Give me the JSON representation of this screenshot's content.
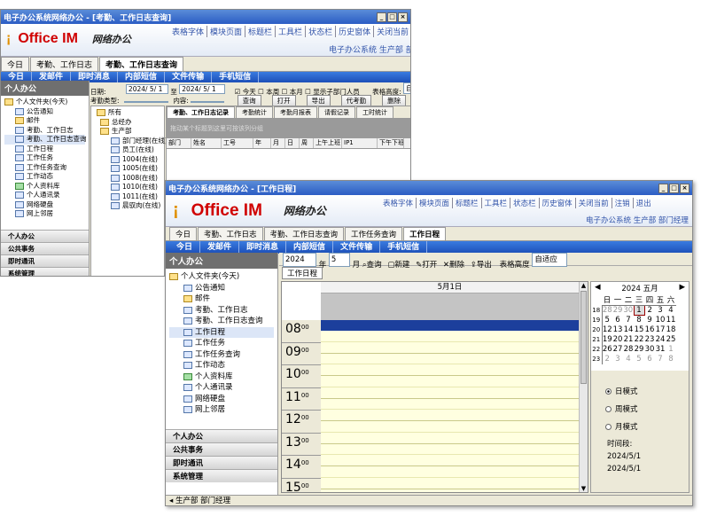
{
  "w1": {
    "title": "电子办公系统网络办公 - [考勤、工作日志查询]",
    "logo": "Office IM",
    "logo_cn": "网络办公",
    "menu": [
      "表格字体",
      "模块页面",
      "标题栏",
      "工具栏",
      "状态栏",
      "历史窗体",
      "关闭当前",
      "注销",
      "退出"
    ],
    "info": "电子办公系统 生产部 部门经理",
    "tabs": [
      "今日",
      "考勤、工作日志",
      "考勤、工作日志查询"
    ],
    "nav": [
      "今日",
      "发邮件",
      "即时消息",
      "内部短信",
      "文件传输",
      "手机短信"
    ],
    "side_title": "个人办公",
    "tree": [
      "个人文件夹(今天)",
      "公告通知",
      "邮件",
      "考勤、工作日志",
      "考勤、工作日志查询",
      "工作日程",
      "工作任务",
      "工作任务查询",
      "工作动态",
      "个人资料库",
      "个人通讯录",
      "网络硬盘",
      "网上邻居"
    ],
    "acc": [
      "个人办公",
      "公共事务",
      "即时通讯",
      "系统管理"
    ],
    "status": "生产部 部门经理",
    "f": {
      "date_label": "日期:",
      "date1": "2024/ 5/ 1",
      "to": "至",
      "date2": "2024/ 5/ 1",
      "today": "今天",
      "week": "本周",
      "month": "本月",
      "subdept": "显示子部门人员",
      "height_label": "表格高度:",
      "height_val": "自适应",
      "type_label": "考勤类型:",
      "content_label": "内容:",
      "btns": [
        "查询",
        "打开",
        "导出",
        "代考勤",
        "删除"
      ]
    },
    "dept": [
      "所有",
      "总经办",
      "生产部",
      "部门经理(在线)",
      "员工(在线)",
      "1004(在线)",
      "1005(在线)",
      "1008(在线)",
      "1010(在线)",
      "1011(在线)",
      "晨驭肉(在线)"
    ],
    "subtabs": [
      "考勤、工作日志记录",
      "考勤统计",
      "考勤月报表",
      "请假记录",
      "工时统计"
    ],
    "group_hint": "拖动某个标题到这里可按该列分组",
    "cols": [
      "部门",
      "姓名",
      "工号",
      "年",
      "月",
      "日",
      "周",
      "上午上班",
      "IP1",
      "下午下班"
    ]
  },
  "w2": {
    "title": "电子办公系统网络办公 - [工作日程]",
    "logo": "Office IM",
    "logo_cn": "网络办公",
    "menu": [
      "表格字体",
      "模块页面",
      "标题栏",
      "工具栏",
      "状态栏",
      "历史窗体",
      "关闭当前",
      "注销",
      "退出"
    ],
    "info": "电子办公系统 生产部 部门经理",
    "tabs": [
      "今日",
      "考勤、工作日志",
      "考勤、工作日志查询",
      "工作任务查询",
      "工作日程"
    ],
    "nav": [
      "今日",
      "发邮件",
      "即时消息",
      "内部短信",
      "文件传输",
      "手机短信"
    ],
    "side_title": "个人办公",
    "tree": [
      "个人文件夹(今天)",
      "公告通知",
      "邮件",
      "考勤、工作日志",
      "考勤、工作日志查询",
      "工作日程",
      "工作任务",
      "工作任务查询",
      "工作动态",
      "个人资料库",
      "个人通讯录",
      "网络硬盘",
      "网上邻居"
    ],
    "acc": [
      "个人办公",
      "公共事务",
      "即时通讯",
      "系统管理"
    ],
    "status": "生产部 部门经理",
    "tool": {
      "year": "2024",
      "year_unit": "年",
      "month": "5",
      "month_unit": "月",
      "query": "查询",
      "new": "新建",
      "open": "打开",
      "del": "删除",
      "export": "导出",
      "height_label": "表格高度",
      "height_val": "自适应"
    },
    "subtab": "工作日程",
    "day_header": "5月1日",
    "hours": [
      {
        "h": "08",
        "m": "00"
      },
      {
        "h": "09",
        "m": "00"
      },
      {
        "h": "10",
        "m": "00"
      },
      {
        "h": "11",
        "m": "00"
      },
      {
        "h": "12",
        "m": "00"
      },
      {
        "h": "13",
        "m": "00"
      },
      {
        "h": "14",
        "m": "00"
      },
      {
        "h": "15",
        "m": "00"
      }
    ],
    "cal": {
      "title": "2024 五月",
      "weekdays": [
        "日",
        "一",
        "二",
        "三",
        "四",
        "五",
        "六"
      ],
      "weeks": [
        [
          "18",
          "28",
          "29",
          "30",
          "1",
          "2",
          "3",
          "4"
        ],
        [
          "19",
          "5",
          "6",
          "7",
          "8",
          "9",
          "10",
          "11"
        ],
        [
          "20",
          "12",
          "13",
          "14",
          "15",
          "16",
          "17",
          "18"
        ],
        [
          "21",
          "19",
          "20",
          "21",
          "22",
          "23",
          "24",
          "25"
        ],
        [
          "22",
          "26",
          "27",
          "28",
          "29",
          "30",
          "31",
          "1"
        ],
        [
          "23",
          "2",
          "3",
          "4",
          "5",
          "6",
          "7",
          "8"
        ]
      ]
    },
    "modes": [
      "日模式",
      "周模式",
      "月模式"
    ],
    "period_label": "时间段:",
    "period_from": "2024/5/1",
    "period_to": "2024/5/1",
    "colors": {
      "accent": "#1c4fb8",
      "event": "#1c3f9c",
      "day_bg": "#ffffe0"
    }
  }
}
